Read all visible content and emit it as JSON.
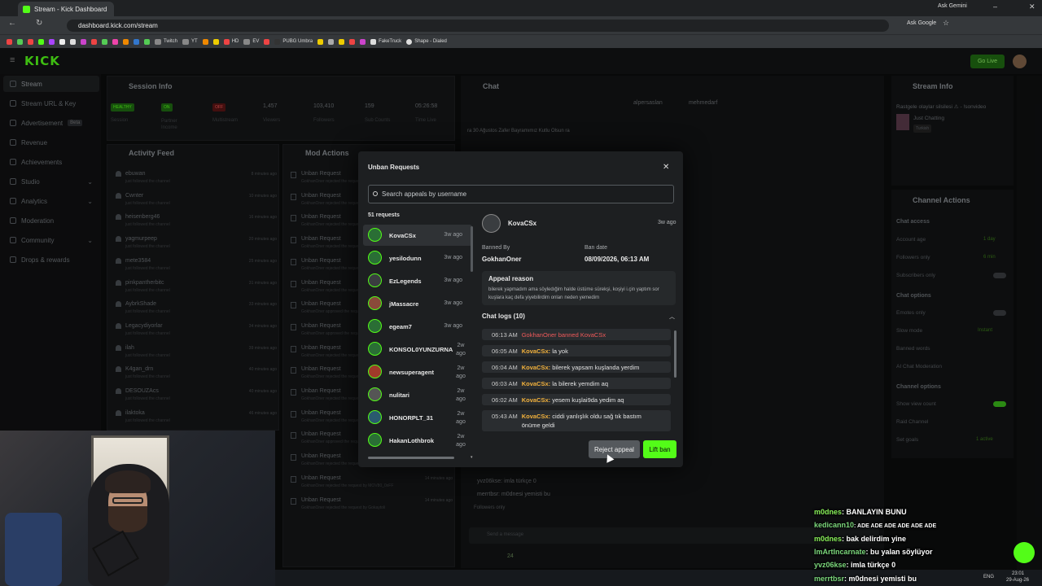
{
  "browser": {
    "tab_title": "Stream - Kick Dashboard",
    "url": "dashboard.kick.com/stream",
    "ask_gemini": "Ask Gemini",
    "ask_google": "Ask Google",
    "bookmarks": [
      "Twitch",
      "YT",
      "HD",
      "EV",
      "PUBG Umbra",
      "FakeTruck",
      "Shape - Dialed"
    ]
  },
  "header": {
    "logo": "KICK",
    "go_live": "Go Live"
  },
  "sidebar": {
    "items": [
      {
        "label": "Stream"
      },
      {
        "label": "Stream URL & Key"
      },
      {
        "label": "Advertisement",
        "badge": "Beta"
      },
      {
        "label": "Revenue"
      },
      {
        "label": "Achievements"
      },
      {
        "label": "Studio"
      },
      {
        "label": "Analytics"
      },
      {
        "label": "Moderation"
      },
      {
        "label": "Community"
      },
      {
        "label": "Drops & rewards"
      }
    ]
  },
  "session_info": {
    "title": "Session Info",
    "stats": [
      {
        "value": "HEALTHY",
        "label": "Session"
      },
      {
        "value": "ON",
        "label": "Partner Income"
      },
      {
        "value": "OFF",
        "label": "Multistream"
      },
      {
        "value": "1,457",
        "label": "Viewers"
      },
      {
        "value": "103,410",
        "label": "Followers"
      },
      {
        "value": "159",
        "label": "Sub Counts"
      },
      {
        "value": "05:26:58",
        "label": "Time Live"
      }
    ]
  },
  "activity_feed": {
    "title": "Activity Feed",
    "sub": "just followed the channel",
    "rows": [
      {
        "name": "ebuwan",
        "time": "8 minutes ago"
      },
      {
        "name": "Cwnter",
        "time": "10 minutes ago"
      },
      {
        "name": "heisenberg46",
        "time": "16 minutes ago"
      },
      {
        "name": "yagmurpeep",
        "time": "20 minutes ago"
      },
      {
        "name": "mete3584",
        "time": "25 minutes ago"
      },
      {
        "name": "pinkpantherbitc",
        "time": "31 minutes ago"
      },
      {
        "name": "AybrkShade",
        "time": "33 minutes ago"
      },
      {
        "name": "Legacydiyorlar",
        "time": "34 minutes ago"
      },
      {
        "name": "ilah",
        "time": "39 minutes ago"
      },
      {
        "name": "K4gan_drn",
        "time": "40 minutes ago"
      },
      {
        "name": "DESOUZAcs",
        "time": "40 minutes ago"
      },
      {
        "name": "ilaktoka",
        "time": "46 minutes ago"
      }
    ]
  },
  "mod_actions": {
    "title": "Mod Actions",
    "rows": [
      {
        "name": "Unban Request",
        "sub": "GokhanOner rejected the request"
      },
      {
        "name": "Unban Request",
        "sub": "GokhanOner rejected the request"
      },
      {
        "name": "Unban Request",
        "sub": "GokhanOner rejected the request"
      },
      {
        "name": "Unban Request",
        "sub": "GokhanOner rejected the request"
      },
      {
        "name": "Unban Request",
        "sub": "GokhanOner rejected the request"
      },
      {
        "name": "Unban Request",
        "sub": "GokhanOner rejected the request"
      },
      {
        "name": "Unban Request",
        "sub": "GokhanOner approved the request"
      },
      {
        "name": "Unban Request",
        "sub": "GokhanOner approved the request"
      },
      {
        "name": "Unban Request",
        "sub": "GokhanOner rejected the request"
      },
      {
        "name": "Unban Request",
        "sub": "GokhanOner rejected the request"
      },
      {
        "name": "Unban Request",
        "sub": "GokhanOner rejected the request"
      },
      {
        "name": "Unban Request",
        "sub": "GokhanOner rejected the request"
      },
      {
        "name": "Unban Request",
        "sub": "GokhanOner approved the request by Kilizacar",
        "time": "13 minutes ago"
      },
      {
        "name": "Unban Request",
        "sub": "GokhanOner rejected the request by torramague",
        "time": "14 minutes ago"
      },
      {
        "name": "Unban Request",
        "sub": "GokhanOner rejected the request by MOV80_0xFF",
        "time": "14 minutes ago"
      },
      {
        "name": "Unban Request",
        "sub": "GokhanOner rejected the request by Gokaytoli",
        "time": "14 minutes ago"
      }
    ]
  },
  "modal": {
    "title": "Unban Requests",
    "search_placeholder": "Search appeals by username",
    "count": "51 requests",
    "requests": [
      {
        "name": "KovaCSx",
        "time": "3w ago"
      },
      {
        "name": "yesilodunn",
        "time": "3w ago"
      },
      {
        "name": "EzLegends",
        "time": "3w ago"
      },
      {
        "name": "jMassacre",
        "time": "3w ago"
      },
      {
        "name": "egeam7",
        "time": "3w ago"
      },
      {
        "name": "KONSOL0YUNZURNA",
        "time": "2w ago"
      },
      {
        "name": "newsuperagent",
        "time": "2w ago"
      },
      {
        "name": "nulitari",
        "time": "2w ago"
      },
      {
        "name": "HONORPLT_31",
        "time": "2w ago"
      },
      {
        "name": "HakanLothbrok",
        "time": "2w ago"
      }
    ],
    "detail": {
      "name": "KovaCSx",
      "time": "3w ago",
      "banned_by_label": "Banned By",
      "banned_by": "GokhanOner",
      "ban_date_label": "Ban date",
      "ban_date": "08/09/2026, 06:13 AM",
      "appeal_title": "Appeal reason",
      "appeal_text": "bilerek yapmadım ama söyledığim halde üstüme sürekşi, koşiyi i.çin yaptım sor kuşlara kaç defa yiyebilirdim onları neden yemedim",
      "chatlogs_title": "Chat logs (10)",
      "logs": [
        {
          "time": "06:13 AM",
          "user": "GokhanOner banned KovaCSx",
          "msg": "",
          "system": true
        },
        {
          "time": "06:05 AM",
          "user": "KovaCSx:",
          "msg": " la yok"
        },
        {
          "time": "06:04 AM",
          "user": "KovaCSx:",
          "msg": " bilerek yapsam kuşlanda yerdim"
        },
        {
          "time": "06:03 AM",
          "user": "KovaCSx:",
          "msg": " la bilerek yemdim aq"
        },
        {
          "time": "06:02 AM",
          "user": "KovaCSx:",
          "msg": " yesem kuşlai9da yedim aq"
        },
        {
          "time": "05:43 AM",
          "user": "KovaCSx:",
          "msg": " ciddi yanlışlık oldu sağ tık bastım önüme geldi"
        }
      ]
    },
    "reject_label": "Reject appeal",
    "lift_label": "Lift ban"
  },
  "chat": {
    "title": "Chat",
    "top_users": [
      "alpersaslan",
      "mehmedarf"
    ],
    "pinned": "ra 30 Ağustos Zafer Bayramımız Kutlu Olsun ra",
    "lines": [
      "yvz06kse: imla türkçe 0",
      "merrtbsr: m0dnesi yemisti bu"
    ],
    "followers_only": "Followers only",
    "send_placeholder": "Send a message",
    "count": "24"
  },
  "stream_info": {
    "title": "Stream Info",
    "stream_title": "Rastgele olaylar silsilesi ⚠ - !sonvideo",
    "category": "Just Chatting",
    "tag": "Turkish"
  },
  "channel_actions": {
    "title": "Channel Actions",
    "chat_access": "Chat access",
    "account_age": "Account age",
    "account_age_val": "1 day",
    "followers_only": "Followers only",
    "followers_only_val": "6 min",
    "subscribers_only": "Subscribers only",
    "chat_options": "Chat options",
    "emotes_only": "Emotes only",
    "slow_mode": "Slow mode",
    "slow_mode_val": "Instant",
    "banned_words": "Banned words",
    "ai_moderation": "AI Chat Moderation",
    "channel_options": "Channel options",
    "show_view_count": "Show view count",
    "raid_channel": "Raid Channel",
    "set_goals": "Set goals",
    "set_goals_val": "1 active"
  },
  "overlay_chat": [
    {
      "user": "m0dnes",
      "msg": ": BANLAYIN BUNU"
    },
    {
      "user": "kedicann10",
      "msg": ": ADE ADE ADE ADE ADE ADE"
    },
    {
      "user": "m0dnes",
      "msg": ": bak delirdim yine"
    },
    {
      "user": "ImArtIncarnate",
      "msg": ": bu yalan söylüyor"
    },
    {
      "user": "yvz06kse",
      "msg": ": imla türkçe 0"
    },
    {
      "user": "merrtbsr",
      "msg": ": m0dnesi yemisti bu"
    }
  ],
  "taskbar": {
    "lang": "ENG",
    "time": "23:01",
    "date": "29-Aug-26"
  },
  "colors": {
    "kick_green": "#53fc18",
    "username_orange": "#f2b13c",
    "ban_red": "#f05a5a"
  }
}
